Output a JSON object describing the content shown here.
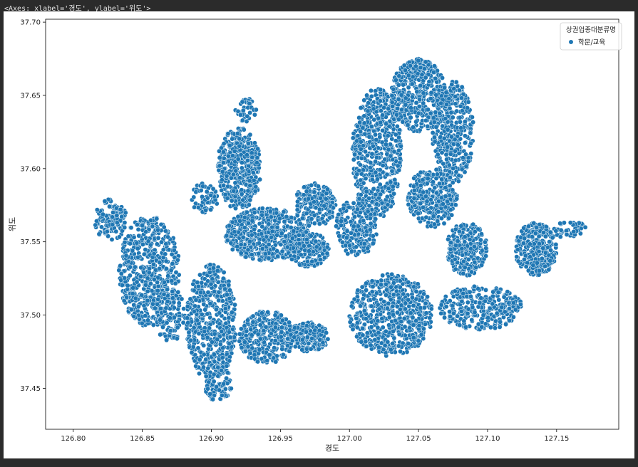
{
  "output": {
    "repr": "<Axes: xlabel='경도', ylabel='위도'>"
  },
  "chart_data": {
    "type": "scatter",
    "xlabel": "경도",
    "ylabel": "위도",
    "xlim": [
      126.78,
      127.195
    ],
    "ylim": [
      37.422,
      37.702
    ],
    "xticks": [
      126.8,
      126.85,
      126.9,
      126.95,
      127.0,
      127.05,
      127.1,
      127.15
    ],
    "xtick_labels": [
      "126.80",
      "126.85",
      "126.90",
      "126.95",
      "127.00",
      "127.05",
      "127.10",
      "127.15"
    ],
    "yticks": [
      37.45,
      37.5,
      37.55,
      37.6,
      37.65,
      37.7
    ],
    "ytick_labels": [
      "37.45",
      "37.50",
      "37.55",
      "37.60",
      "37.65",
      "37.70"
    ],
    "grid": false,
    "legend": {
      "title": "상권업종대분류명",
      "placement": "top-right",
      "entries": [
        "학문/교육"
      ]
    },
    "series": [
      {
        "name": "학문/교육",
        "color": "#1f77b4",
        "marker_edge_color": "#ffffff",
        "clusters": [
          {
            "cx": 126.855,
            "cy": 37.53,
            "rx": 0.022,
            "ry": 0.038,
            "n": 560
          },
          {
            "cx": 126.827,
            "cy": 37.565,
            "rx": 0.012,
            "ry": 0.014,
            "n": 120
          },
          {
            "cx": 126.87,
            "cy": 37.5,
            "rx": 0.012,
            "ry": 0.018,
            "n": 120
          },
          {
            "cx": 126.9,
            "cy": 37.495,
            "rx": 0.018,
            "ry": 0.04,
            "n": 520
          },
          {
            "cx": 126.905,
            "cy": 37.453,
            "rx": 0.01,
            "ry": 0.012,
            "n": 80
          },
          {
            "cx": 126.94,
            "cy": 37.485,
            "rx": 0.02,
            "ry": 0.018,
            "n": 320
          },
          {
            "cx": 126.97,
            "cy": 37.485,
            "rx": 0.015,
            "ry": 0.01,
            "n": 180
          },
          {
            "cx": 127.03,
            "cy": 37.5,
            "rx": 0.03,
            "ry": 0.028,
            "n": 620
          },
          {
            "cx": 127.095,
            "cy": 37.505,
            "rx": 0.03,
            "ry": 0.015,
            "n": 300
          },
          {
            "cx": 127.135,
            "cy": 37.545,
            "rx": 0.015,
            "ry": 0.018,
            "n": 280
          },
          {
            "cx": 127.16,
            "cy": 37.558,
            "rx": 0.012,
            "ry": 0.006,
            "n": 40
          },
          {
            "cx": 126.92,
            "cy": 37.6,
            "rx": 0.016,
            "ry": 0.028,
            "n": 440
          },
          {
            "cx": 126.925,
            "cy": 37.64,
            "rx": 0.008,
            "ry": 0.008,
            "n": 40
          },
          {
            "cx": 126.94,
            "cy": 37.555,
            "rx": 0.03,
            "ry": 0.018,
            "n": 520
          },
          {
            "cx": 126.975,
            "cy": 37.575,
            "rx": 0.015,
            "ry": 0.015,
            "n": 180
          },
          {
            "cx": 126.97,
            "cy": 37.545,
            "rx": 0.015,
            "ry": 0.012,
            "n": 180
          },
          {
            "cx": 127.02,
            "cy": 37.61,
            "rx": 0.018,
            "ry": 0.045,
            "n": 560
          },
          {
            "cx": 127.05,
            "cy": 37.65,
            "rx": 0.02,
            "ry": 0.025,
            "n": 440
          },
          {
            "cx": 127.075,
            "cy": 37.625,
            "rx": 0.015,
            "ry": 0.035,
            "n": 380
          },
          {
            "cx": 127.06,
            "cy": 37.58,
            "rx": 0.018,
            "ry": 0.02,
            "n": 300
          },
          {
            "cx": 127.085,
            "cy": 37.545,
            "rx": 0.015,
            "ry": 0.018,
            "n": 240
          },
          {
            "cx": 127.005,
            "cy": 37.56,
            "rx": 0.015,
            "ry": 0.02,
            "n": 220
          },
          {
            "cx": 126.895,
            "cy": 37.58,
            "rx": 0.01,
            "ry": 0.01,
            "n": 60
          }
        ]
      }
    ]
  }
}
